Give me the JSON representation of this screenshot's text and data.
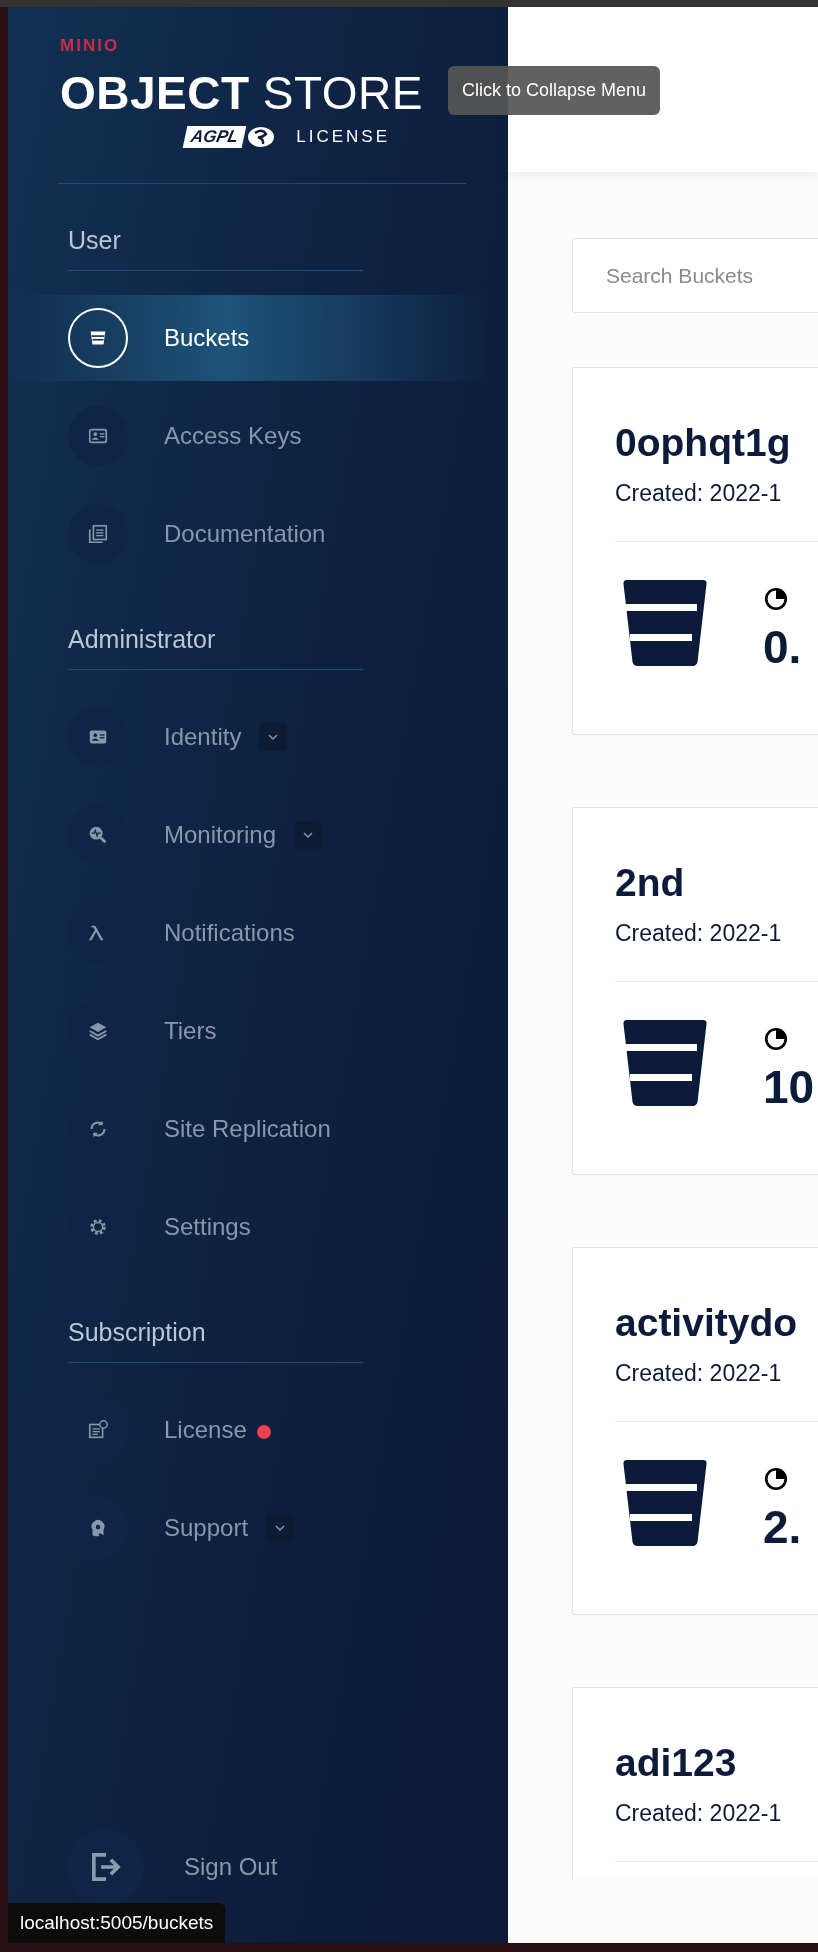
{
  "logo": {
    "brand": "MINIO",
    "product_bold": "OBJECT",
    "product_light": "STORE",
    "license_badge": "AGPL",
    "license": "LICENSE"
  },
  "tooltip": "Click to Collapse Menu",
  "sidebar": {
    "sections": [
      {
        "title": "User",
        "items": [
          {
            "label": "Buckets",
            "selected": true,
            "expandable": false,
            "alert": false
          },
          {
            "label": "Access Keys",
            "selected": false,
            "expandable": false,
            "alert": false
          },
          {
            "label": "Documentation",
            "selected": false,
            "expandable": false,
            "alert": false
          }
        ]
      },
      {
        "title": "Administrator",
        "items": [
          {
            "label": "Identity",
            "selected": false,
            "expandable": true,
            "alert": false
          },
          {
            "label": "Monitoring",
            "selected": false,
            "expandable": true,
            "alert": false
          },
          {
            "label": "Notifications",
            "selected": false,
            "expandable": false,
            "alert": false
          },
          {
            "label": "Tiers",
            "selected": false,
            "expandable": false,
            "alert": false
          },
          {
            "label": "Site Replication",
            "selected": false,
            "expandable": false,
            "alert": false
          },
          {
            "label": "Settings",
            "selected": false,
            "expandable": false,
            "alert": false
          }
        ]
      },
      {
        "title": "Subscription",
        "items": [
          {
            "label": "License",
            "selected": false,
            "expandable": false,
            "alert": true
          },
          {
            "label": "Support",
            "selected": false,
            "expandable": true,
            "alert": false
          }
        ]
      }
    ],
    "sign_out": "Sign Out"
  },
  "search": {
    "placeholder": "Search Buckets"
  },
  "buckets": [
    {
      "name": "0ophqt1g",
      "created": "Created: 2022-1",
      "usage": "0."
    },
    {
      "name": "2nd",
      "created": "Created: 2022-1",
      "usage": "10"
    },
    {
      "name": "activitydo",
      "created": "Created: 2022-1",
      "usage": "2."
    },
    {
      "name": "adi123",
      "created": "Created: 2022-1"
    }
  ],
  "status_url": "localhost:5005/buckets"
}
